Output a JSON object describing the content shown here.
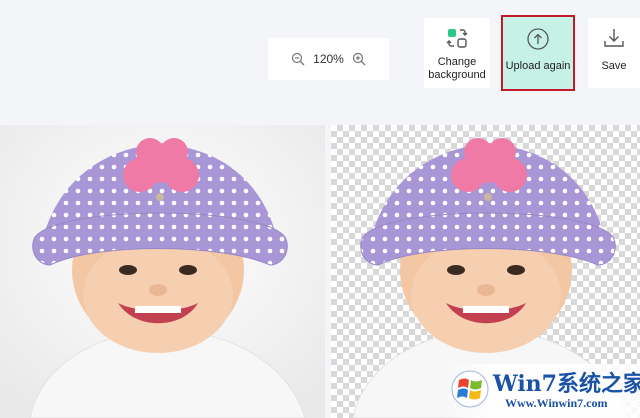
{
  "toolbar": {
    "zoom_level": "120%",
    "zoom_out_icon": "zoom-out-icon",
    "zoom_in_icon": "zoom-in-icon",
    "change_background_label": "Change background",
    "upload_again_label": "Upload again",
    "save_label": "Save"
  },
  "colors": {
    "page_bg": "#f4f5f8",
    "upload_button_bg": "#c6f2e6",
    "upload_button_border": "#c3192b",
    "swatch_green": "#2dc98b",
    "watermark_blue": "#1a52a8"
  },
  "watermark": {
    "title": "Win7系统之家",
    "url": "Www.Winwin7.com"
  }
}
